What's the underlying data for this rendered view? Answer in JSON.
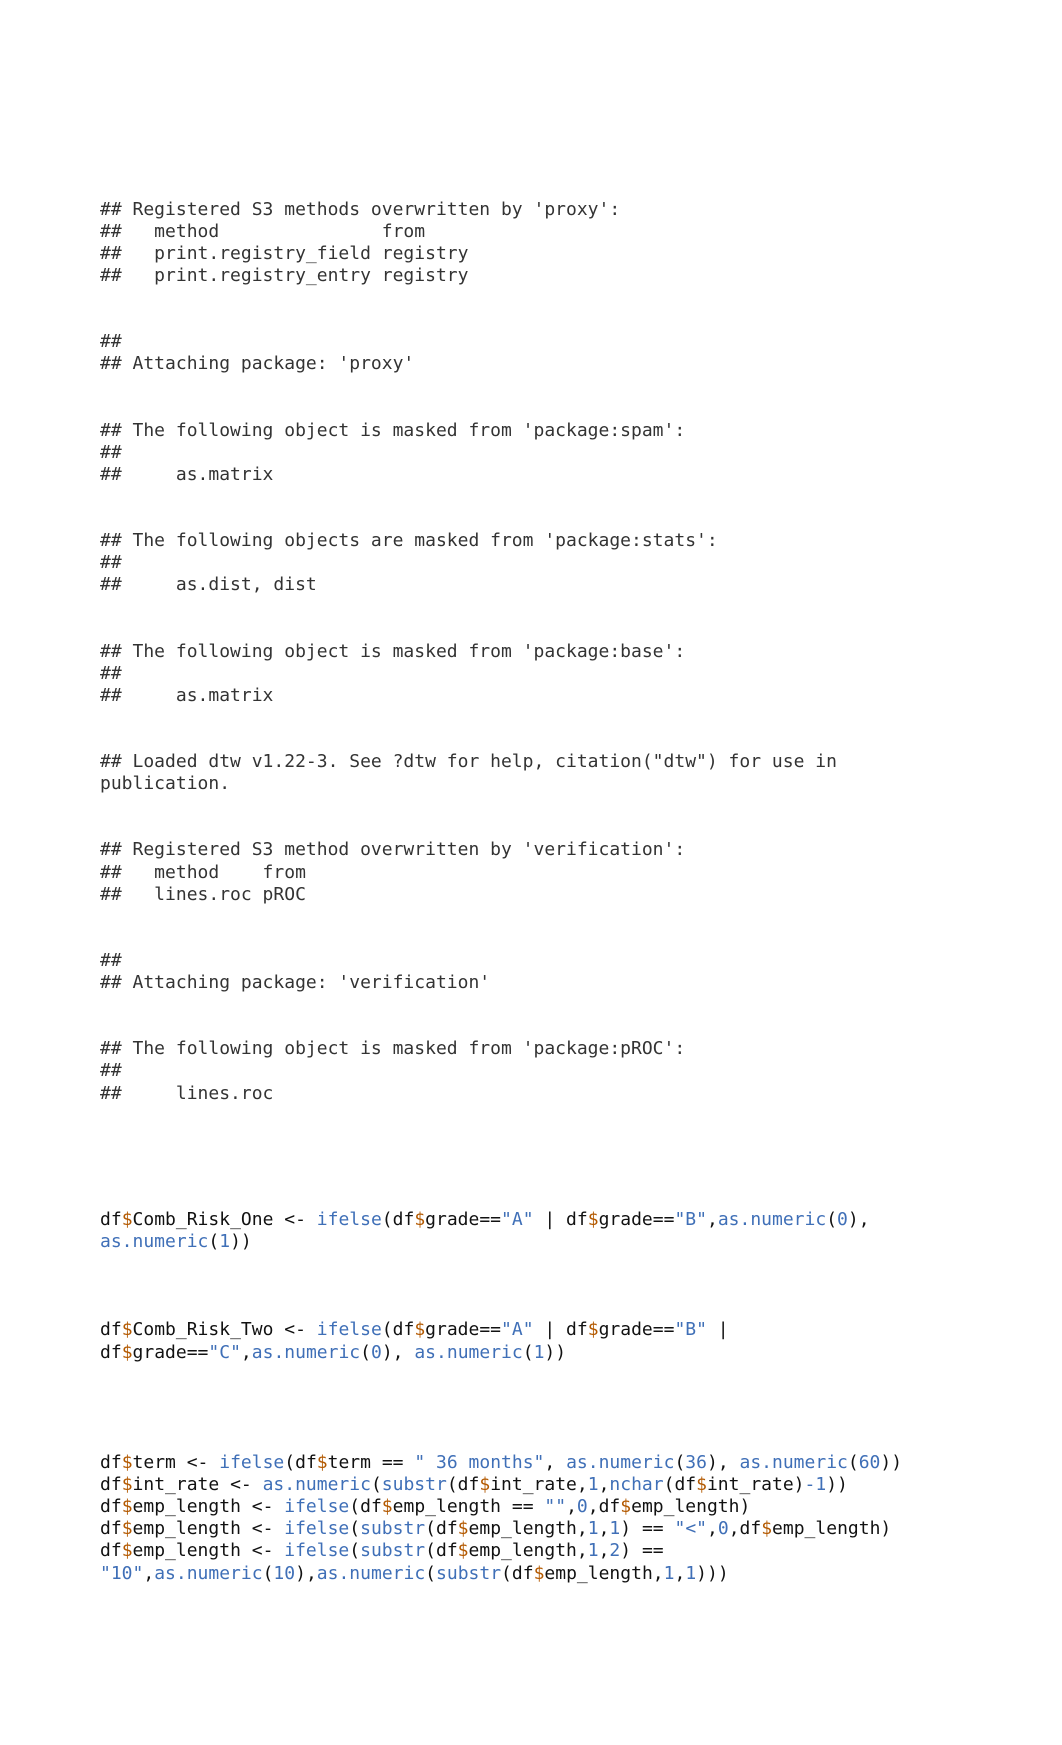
{
  "output": {
    "block1": "## Registered S3 methods overwritten by 'proxy':\n##   method               from    \n##   print.registry_field registry\n##   print.registry_entry registry",
    "block2": "## \n## Attaching package: 'proxy'",
    "block3a": "## The following object is masked from 'package:spam':\n## ",
    "block3b": "##     as.matrix",
    "block4a": "## The following objects are masked from 'package:stats':\n## ",
    "block4b": "##     as.dist, dist",
    "block5a": "## The following object is masked from 'package:base':\n## ",
    "block5b": "##     as.matrix",
    "block6": "## Loaded dtw v1.22-3. See ?dtw for help, citation(\"dtw\") for use in publication.",
    "block7": "## Registered S3 method overwritten by 'verification':\n##   method    from\n##   lines.roc pROC",
    "block8": "## \n## Attaching package: 'verification'",
    "block9a": "## The following object is masked from 'package:pROC':\n## ",
    "block9b": "##     lines.roc"
  },
  "code": {
    "c1": {
      "p1": "df",
      "p2": "$",
      "p3": "Comb_Risk_One <- ",
      "p4": "ifelse",
      "p5": "(df",
      "p6": "$",
      "p7": "grade",
      "p8": "==",
      "p9": "\"A\"",
      "p10": " | df",
      "p11": "$",
      "p12": "grade",
      "p13": "==",
      "p14": "\"B\"",
      "p15": ",",
      "p16": "as.numeric",
      "p17": "(",
      "p18": "0",
      "p19": "), ",
      "p20": "as.numeric",
      "p21": "(",
      "p22": "1",
      "p23": "))"
    },
    "c2": {
      "p1": "df",
      "p2": "$",
      "p3": "Comb_Risk_Two <- ",
      "p4": "ifelse",
      "p5": "(df",
      "p6": "$",
      "p7": "grade",
      "p8": "==",
      "p9": "\"A\"",
      "p10": " | df",
      "p11": "$",
      "p12": "grade",
      "p13": "==",
      "p14": "\"B\"",
      "p15": " | df",
      "p16": "$",
      "p17": "grade",
      "p18": "==",
      "p19": "\"C\"",
      "p20": ",",
      "p21": "as.numeric",
      "p22": "(",
      "p23": "0",
      "p24": "), ",
      "p25": "as.numeric",
      "p26": "(",
      "p27": "1",
      "p28": "))"
    },
    "c3": {
      "p1": "df",
      "p2": "$",
      "p3": "term <- ",
      "p4": "ifelse",
      "p5": "(df",
      "p6": "$",
      "p7": "term ",
      "p8": "==",
      "p9": " \" 36 months\"",
      "p10": ", ",
      "p11": "as.numeric",
      "p12": "(",
      "p13": "36",
      "p14": "), ",
      "p15": "as.numeric",
      "p16": "(",
      "p17": "60",
      "p18": "))"
    },
    "c4": {
      "p1": "df",
      "p2": "$",
      "p3": "int_rate <- ",
      "p4": "as.numeric",
      "p5": "(",
      "p6": "substr",
      "p7": "(df",
      "p8": "$",
      "p9": "int_rate,",
      "p10": "1",
      "p11": ",",
      "p12": "nchar",
      "p13": "(df",
      "p14": "$",
      "p15": "int_rate)",
      "p16": "-",
      "p17": "1",
      "p18": "))"
    },
    "c5": {
      "p1": "df",
      "p2": "$",
      "p3": "emp_length <- ",
      "p4": "ifelse",
      "p5": "(df",
      "p6": "$",
      "p7": "emp_length ",
      "p8": "==",
      "p9": " \"\"",
      "p10": ",",
      "p11": "0",
      "p12": ",df",
      "p13": "$",
      "p14": "emp_length)"
    },
    "c6": {
      "p1": "df",
      "p2": "$",
      "p3": "emp_length <- ",
      "p4": "ifelse",
      "p5": "(",
      "p6": "substr",
      "p7": "(df",
      "p8": "$",
      "p9": "emp_length,",
      "p10": "1",
      "p11": ",",
      "p12": "1",
      "p13": ") ",
      "p14": "==",
      "p15": " \"<\"",
      "p16": ",",
      "p17": "0",
      "p18": ",df",
      "p19": "$",
      "p20": "emp_length)"
    },
    "c7": {
      "p1": "df",
      "p2": "$",
      "p3": "emp_length <- ",
      "p4": "ifelse",
      "p5": "(",
      "p6": "substr",
      "p7": "(df",
      "p8": "$",
      "p9": "emp_length,",
      "p10": "1",
      "p11": ",",
      "p12": "2",
      "p13": ") ",
      "p14": "==",
      "p15": " \"10\"",
      "p16": ",",
      "p17": "as.numeric",
      "p18": "(",
      "p19": "10",
      "p20": "),",
      "p21": "as.numeric",
      "p22": "(",
      "p23": "substr",
      "p24": "(df",
      "p25": "$",
      "p26": "emp_length,",
      "p27": "1",
      "p28": ",",
      "p29": "1",
      "p30": ")))"
    }
  }
}
